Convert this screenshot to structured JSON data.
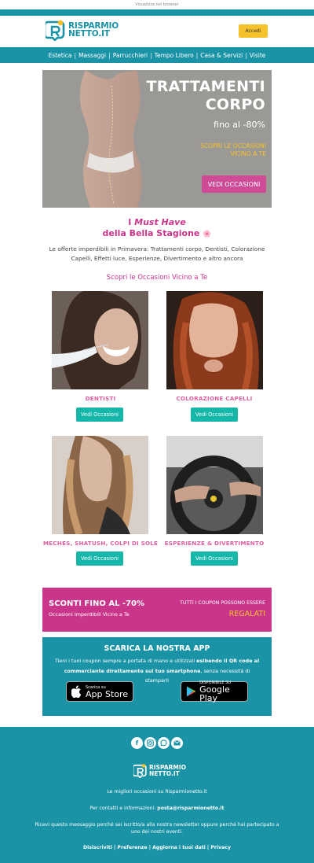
{
  "browser": {
    "view_link": "Visualizza nel browser"
  },
  "header": {
    "logo_line1": "RISPARMIO",
    "logo_line2": "NETTO.IT",
    "login_label": "Accedi"
  },
  "nav": {
    "items": [
      "Estetica",
      "Massaggi",
      "Parrucchieri",
      "Tempo Libero",
      "Casa & Servizi",
      "Visite"
    ]
  },
  "hero": {
    "title_line1": "TRATTAMENTI",
    "title_line2": "CORPO",
    "subtitle": "fino al -80%",
    "occasions_line1": "SCOPRI LE OCCASIONI",
    "occasions_line2": "VICINO A TE",
    "button": "VEDI OCCASIONI"
  },
  "promo": {
    "prefix": "I ",
    "emphasis": "Must Have",
    "line2": "della Bella Stagione",
    "flower": "🌸",
    "description": "Le offerte imperdibili in Primavera: Trattamenti corpo, Dentisti, Colorazione Capelli, Effetti luce, Esperienze, Divertimento e altro ancora",
    "scopri": "Scopri le Occasioni Vicino a Te"
  },
  "cards": [
    {
      "title": "DENTISTI",
      "button": "Vedi Occasioni"
    },
    {
      "title": "COLORAZIONE CAPELLI",
      "button": "Vedi Occasioni"
    },
    {
      "title": "MECHES, SHATUSH, COLPI DI SOLE",
      "button": "Vedi Occasioni"
    },
    {
      "title": "ESPERIENZE & DIVERTIMENTO",
      "button": "Vedi Occasioni"
    }
  ],
  "sconti": {
    "title": "SCONTI FINO AL -70%",
    "subtitle": "Occasioni Imperdibili Vicino a Te",
    "right_line1": "TUTTI I COUPON POSSONO ESSERE",
    "right_line2": "REGALATI"
  },
  "app": {
    "title": "SCARICA LA NOSTRA APP",
    "text_part1": "Tieni i tuoi coupon sempre a portata di mano e utilizzali ",
    "text_bold": "esibendo il QR code al commerciante direttamente sul tuo smartphone",
    "text_part2": ", senza necessità di stamparli",
    "appstore_small": "Scarica su",
    "appstore_big": "App Store",
    "googleplay_small": "DISPONIBILE SU",
    "googleplay_big": "Google Play"
  },
  "footer": {
    "social": [
      "facebook-icon",
      "instagram-icon",
      "whatsapp-icon",
      "email-icon"
    ],
    "logo_line1": "RISPARMIO",
    "logo_line2": "NETTO.IT",
    "tagline": "Le migliori occasioni su Risparmionetto.it",
    "contact_prefix": "Per contatti e informazioni: ",
    "contact_email": "posta@risparmionetto.it",
    "notice_line1": "Ricevi questo messaggio perché sei iscritto/a alla nostra newsletter oppure perché hai partecipato a",
    "notice_line2": "uno dei nostri eventi.",
    "links": [
      "Disiscriviti",
      "Preferenze",
      "Aggiorna i tuoi dati",
      "Privacy"
    ]
  },
  "colors": {
    "teal": "#1a93a6",
    "magenta": "#c9358a",
    "pink_text": "#e05f9f",
    "yellow": "#f6c22b",
    "button_teal": "#14b7a9"
  }
}
